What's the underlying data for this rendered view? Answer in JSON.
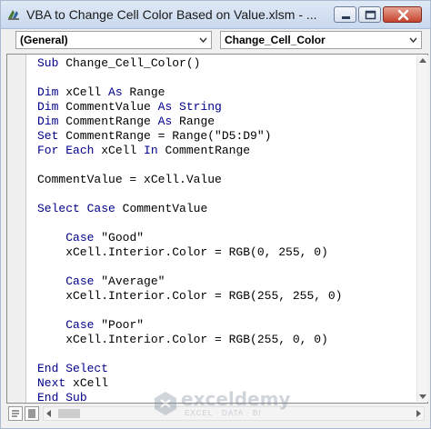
{
  "window": {
    "title": "VBA to Change Cell Color Based on Value.xlsm - ..."
  },
  "dropdowns": {
    "object": "(General)",
    "procedure": "Change_Cell_Color"
  },
  "code_lines": [
    [
      {
        "t": "Sub",
        "k": true
      },
      {
        "t": " Change_Cell_Color()"
      }
    ],
    [],
    [
      {
        "t": "Dim",
        "k": true
      },
      {
        "t": " xCell "
      },
      {
        "t": "As",
        "k": true
      },
      {
        "t": " Range"
      }
    ],
    [
      {
        "t": "Dim",
        "k": true
      },
      {
        "t": " CommentValue "
      },
      {
        "t": "As",
        "k": true
      },
      {
        "t": " "
      },
      {
        "t": "String",
        "k": true
      }
    ],
    [
      {
        "t": "Dim",
        "k": true
      },
      {
        "t": " CommentRange "
      },
      {
        "t": "As",
        "k": true
      },
      {
        "t": " Range"
      }
    ],
    [
      {
        "t": "Set",
        "k": true
      },
      {
        "t": " CommentRange = Range(\"D5:D9\")"
      }
    ],
    [
      {
        "t": "For",
        "k": true
      },
      {
        "t": " "
      },
      {
        "t": "Each",
        "k": true
      },
      {
        "t": " xCell "
      },
      {
        "t": "In",
        "k": true
      },
      {
        "t": " CommentRange"
      }
    ],
    [],
    [
      {
        "t": "CommentValue = xCell.Value"
      }
    ],
    [],
    [
      {
        "t": "Select",
        "k": true
      },
      {
        "t": " "
      },
      {
        "t": "Case",
        "k": true
      },
      {
        "t": " CommentValue"
      }
    ],
    [],
    [
      {
        "t": "    "
      },
      {
        "t": "Case",
        "k": true
      },
      {
        "t": " \"Good\""
      }
    ],
    [
      {
        "t": "    xCell.Interior.Color = RGB(0, 255, 0)"
      }
    ],
    [],
    [
      {
        "t": "    "
      },
      {
        "t": "Case",
        "k": true
      },
      {
        "t": " \"Average\""
      }
    ],
    [
      {
        "t": "    xCell.Interior.Color = RGB(255, 255, 0)"
      }
    ],
    [],
    [
      {
        "t": "    "
      },
      {
        "t": "Case",
        "k": true
      },
      {
        "t": " \"Poor\""
      }
    ],
    [
      {
        "t": "    xCell.Interior.Color = RGB(255, 0, 0)"
      }
    ],
    [],
    [
      {
        "t": "End",
        "k": true
      },
      {
        "t": " "
      },
      {
        "t": "Select",
        "k": true
      }
    ],
    [
      {
        "t": "Next",
        "k": true
      },
      {
        "t": " xCell"
      }
    ],
    [
      {
        "t": "End",
        "k": true
      },
      {
        "t": " "
      },
      {
        "t": "Sub",
        "k": true
      }
    ]
  ],
  "watermark": {
    "name": "exceldemy",
    "tagline": "EXCEL · DATA · BI"
  },
  "icons": {
    "app": "vba-editor-icon",
    "minimize": "minimize-icon",
    "maximize": "maximize-icon",
    "close": "close-icon",
    "dropdown": "chevron-down-icon"
  },
  "colors": {
    "keyword": "#00008b",
    "text": "#000000",
    "titlebar": "#c9d9ee",
    "close_button": "#c4432d"
  }
}
